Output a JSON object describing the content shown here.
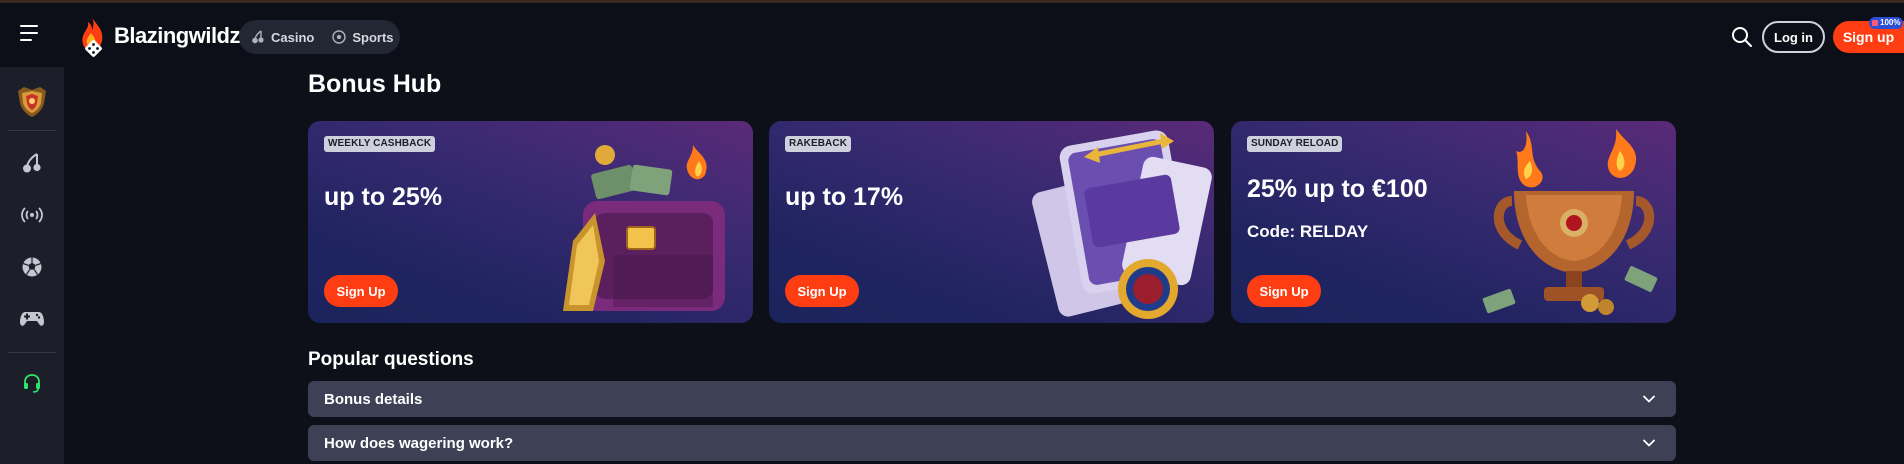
{
  "header": {
    "brand": "Blazingwildz",
    "nav": [
      {
        "label": "Casino",
        "icon": "cherries-icon"
      },
      {
        "label": "Sports",
        "icon": "soccer-ball-icon"
      }
    ],
    "login_label": "Log in",
    "signup_label": "Sign up",
    "signup_badge": "100%"
  },
  "sidebar": {
    "items": [
      {
        "icon": "shield-emblem-icon"
      },
      {
        "icon": "cherries-icon"
      },
      {
        "icon": "live-broadcast-icon"
      },
      {
        "icon": "soccer-ball-icon"
      },
      {
        "icon": "gamepad-icon"
      },
      {
        "icon": "headset-support-icon"
      }
    ]
  },
  "main": {
    "title": "Bonus Hub",
    "bonuses": [
      {
        "tag": "WEEKLY CASHBACK",
        "headline": "up to 25%",
        "code": "",
        "button": "Sign Up",
        "art": "cashback-wallet-image"
      },
      {
        "tag": "RAKEBACK",
        "headline": "up to 17%",
        "code": "",
        "button": "Sign Up",
        "art": "rakeback-cards-image"
      },
      {
        "tag": "SUNDAY RELOAD",
        "headline": "25% up to €100",
        "code": "Code: RELDAY",
        "button": "Sign Up",
        "art": "flaming-trophy-image"
      }
    ],
    "faq_title": "Popular questions",
    "faq": [
      {
        "question": "Bonus details"
      },
      {
        "question": "How does wagering work?"
      }
    ]
  },
  "colors": {
    "accent": "#ff3d12",
    "background": "#0d1018",
    "sidebar": "#1c1f2a",
    "faq_row": "#3e4055",
    "support_icon": "#2ee66b"
  }
}
